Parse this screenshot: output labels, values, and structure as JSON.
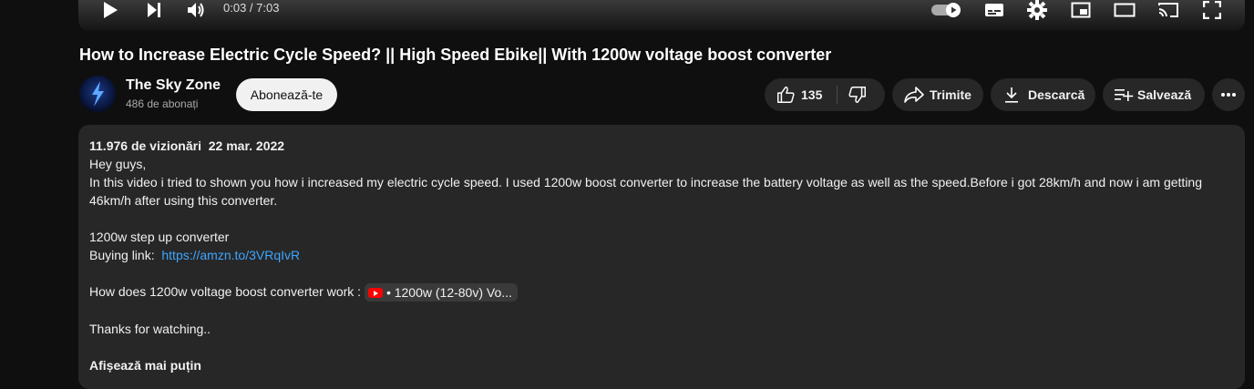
{
  "player": {
    "time": "0:03 / 7:03"
  },
  "video": {
    "title": "How to Increase Electric Cycle Speed? || High Speed Ebike|| With 1200w voltage boost converter"
  },
  "channel": {
    "name": "The Sky Zone",
    "subscribers": "486 de abonați",
    "subscribe_label": "Abonează-te"
  },
  "actions": {
    "like_count": "135",
    "share_label": "Trimite",
    "download_label": "Descarcă",
    "save_label": "Salvează"
  },
  "description": {
    "views": "11.976 de vizionări",
    "date": "22 mar. 2022",
    "line1": "Hey guys,",
    "line2": "In this video i tried to shown you how i increased my electric cycle speed. I used 1200w boost converter to increase the battery voltage as well as the speed.Before i got 28km/h and now i am getting 46km/h after using this converter.",
    "line3": "1200w step up converter",
    "buying_label": "Buying link:",
    "buying_url": "https://amzn.to/3VRqIvR",
    "how_label": "How does 1200w voltage boost converter work :",
    "chip_text": "• 1200w (12-80v) Vo...",
    "thanks": "Thanks for watching..",
    "show_less": "Afișează mai puțin"
  },
  "colors": {
    "background": "#0f0f0f",
    "surface": "#272727",
    "link": "#3ea6ff",
    "youtube_red": "#ff0000"
  }
}
